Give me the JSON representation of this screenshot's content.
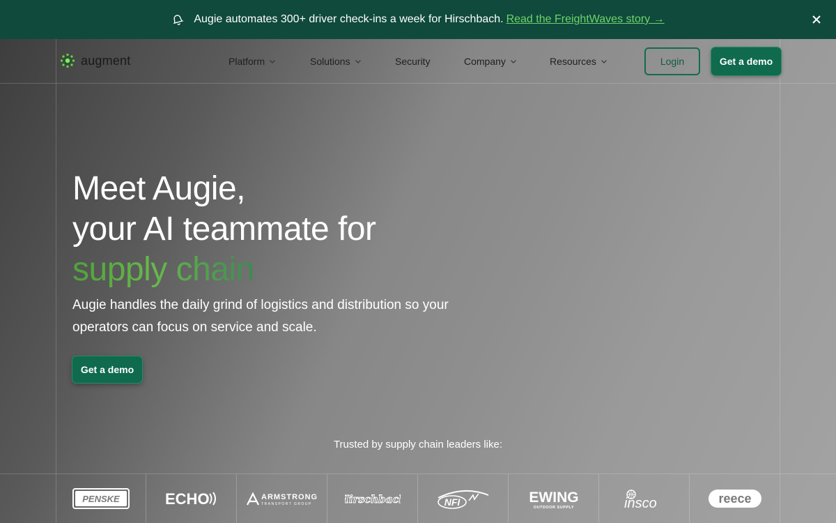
{
  "announcement": {
    "message": "Augie automates 300+ driver check-ins a week for Hirschbach.",
    "link_text": "Read the FreightWaves story →"
  },
  "nav": {
    "brand": "augment",
    "items": [
      {
        "label": "Platform",
        "dropdown": true
      },
      {
        "label": "Solutions",
        "dropdown": true
      },
      {
        "label": "Security",
        "dropdown": false
      },
      {
        "label": "Company",
        "dropdown": true
      },
      {
        "label": "Resources",
        "dropdown": true
      }
    ],
    "login_label": "Login",
    "demo_label": "Get a demo"
  },
  "hero": {
    "title_line1": "Meet Augie,",
    "title_line2": "your AI teammate for",
    "title_accent": "supply chain",
    "subtitle": "Augie handles the daily grind of logistics and distribution so your operators can focus on service and scale.",
    "cta_label": "Get a demo",
    "trusted_label": "Trusted by supply chain leaders like:"
  },
  "customer_logos": [
    {
      "name": "PENSKE"
    },
    {
      "name": "ECHO"
    },
    {
      "name": "ARMSTRONG",
      "tagline": "TRANSPORT GROUP"
    },
    {
      "name": "Hirschbach"
    },
    {
      "name": "NFI"
    },
    {
      "name": "EWING",
      "tagline": "OUTDOOR SUPPLY"
    },
    {
      "name": "insco"
    },
    {
      "name": "reece"
    }
  ],
  "colors": {
    "announcement_bg": "#0f4a3c",
    "primary_button": "#0f6a4e",
    "link_green": "#6fd36a",
    "accent_green": "#4fa23a"
  }
}
